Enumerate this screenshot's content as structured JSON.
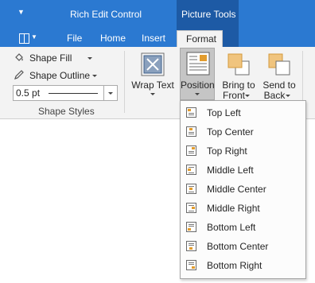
{
  "app": {
    "title": "Rich Edit Control"
  },
  "quick_access": {
    "icon": "customize-arrow-icon"
  },
  "context_group": {
    "label": "Picture Tools"
  },
  "tabs": [
    {
      "label": "File"
    },
    {
      "label": "Home"
    },
    {
      "label": "Insert"
    },
    {
      "label": "Format",
      "active": true
    }
  ],
  "shape_styles": {
    "fill_label": "Shape Fill",
    "outline_label": "Shape Outline",
    "weight_value": "0.5 pt",
    "group_label": "Shape Styles"
  },
  "arrange": {
    "wrap_text_label": "Wrap Text",
    "position_label": "Position",
    "bring_to_front_label_1": "Bring to",
    "bring_to_front_label_2": "Front",
    "send_to_back_label_1": "Send to",
    "send_to_back_label_2": "Back"
  },
  "position_menu": {
    "items": [
      {
        "label": "Top Left",
        "icon": "position-top-left-icon"
      },
      {
        "label": "Top Center",
        "icon": "position-top-center-icon"
      },
      {
        "label": "Top Right",
        "icon": "position-top-right-icon"
      },
      {
        "label": "Middle Left",
        "icon": "position-middle-left-icon"
      },
      {
        "label": "Middle Center",
        "icon": "position-middle-center-icon"
      },
      {
        "label": "Middle Right",
        "icon": "position-middle-right-icon"
      },
      {
        "label": "Bottom Left",
        "icon": "position-bottom-left-icon"
      },
      {
        "label": "Bottom Center",
        "icon": "position-bottom-center-icon"
      },
      {
        "label": "Bottom Right",
        "icon": "position-bottom-right-icon"
      }
    ]
  },
  "colors": {
    "titlebar": "#2b79d1",
    "context_tab": "#1d5aa5",
    "accent_orange": "#e29c2e"
  }
}
